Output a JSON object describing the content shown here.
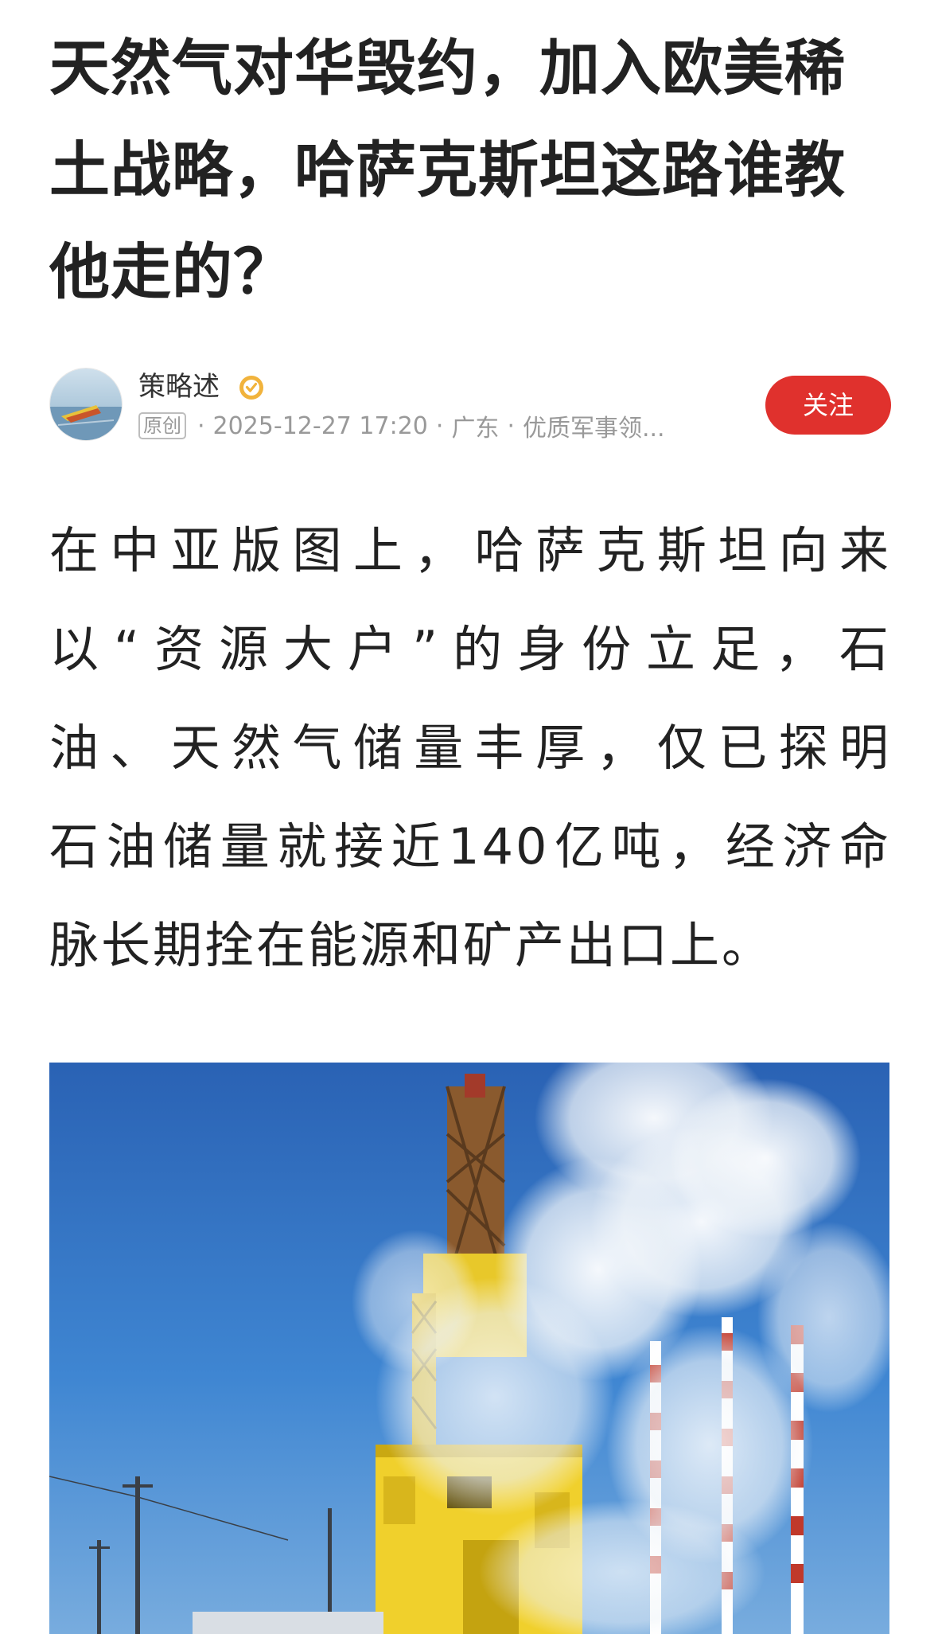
{
  "article": {
    "title_lines": [
      "天然气对华毁约，加入欧美稀",
      "土战略，哈萨克斯坦这路谁教",
      "他走的？"
    ],
    "body_lines": [
      "在中亚版图上，哈萨克斯坦向来",
      "以“资源大户”的身份立足，石",
      "油、天然气储量丰厚，仅已探明",
      "石油储量就接近140亿吨，经济命",
      "脉长期拴在能源和矿产出口上。"
    ]
  },
  "author": {
    "name": "策略述",
    "original_badge": "原创",
    "timestamp": "2025-12-27 17:20",
    "location": "广东",
    "tag": "优质军事领...",
    "separator": "·",
    "follow_label": "关注",
    "verified_icon": "verified-badge-icon"
  },
  "colors": {
    "accent": "#e0312d",
    "verified": "#f1b33c",
    "text": "#222222",
    "meta": "#999999"
  }
}
